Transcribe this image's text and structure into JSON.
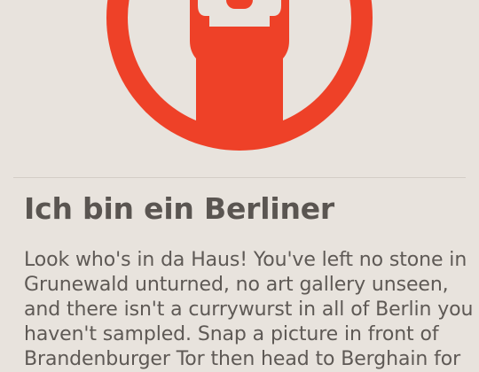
{
  "badge": {
    "icon": "raised-arms-achievement-icon",
    "colors": {
      "primary": "#ee4128",
      "background": "#e8e3dd"
    }
  },
  "achievement": {
    "title": "Ich bin ein Berliner",
    "description": "Look who's in da Haus! You've left no stone in Grunewald unturned, no art gallery unseen, and there isn't a currywurst in all of Berlin you haven't sampled. Snap a picture in front of Brandenburger Tor then head to Berghain for"
  }
}
